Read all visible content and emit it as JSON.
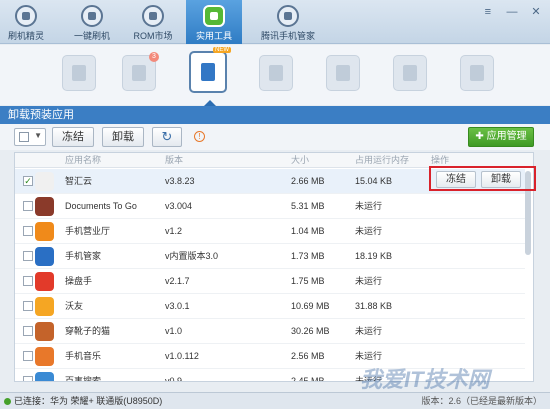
{
  "nav": {
    "items": [
      {
        "label": "刷机精灵",
        "icon": "logo-icon"
      },
      {
        "label": "一键刷机",
        "icon": "flash-icon"
      },
      {
        "label": "ROM市场",
        "icon": "rom-market-icon"
      },
      {
        "label": "实用工具",
        "icon": "tools-icon",
        "active": true
      },
      {
        "label": "腾讯手机管家",
        "icon": "shield-icon"
      }
    ],
    "window_buttons": [
      "≡",
      "—",
      "✕"
    ]
  },
  "tools": {
    "badge_count": "3",
    "new_tag": "NEW"
  },
  "section": {
    "title": "卸载预装应用"
  },
  "toolbar": {
    "freeze_label": "冻结",
    "uninstall_label": "卸载",
    "refresh_icon": "↻",
    "warn_icon": "!",
    "app_manage_label": "应用管理"
  },
  "table": {
    "columns": [
      "应用名称",
      "版本",
      "大小",
      "占用运行内存",
      "操作"
    ],
    "rows": [
      {
        "checked": true,
        "name": "智汇云",
        "version": "v3.8.23",
        "size": "2.66 MB",
        "memory": "15.04 KB",
        "color": "#f0f0f0"
      },
      {
        "checked": false,
        "name": "Documents To Go",
        "version": "v3.004",
        "size": "5.31 MB",
        "memory": "未运行",
        "color": "#8a3a2a"
      },
      {
        "checked": false,
        "name": "手机营业厅",
        "version": "v1.2",
        "size": "1.04 MB",
        "memory": "未运行",
        "color": "#f08a1a"
      },
      {
        "checked": false,
        "name": "手机管家",
        "version": "v内置版本3.0",
        "size": "1.73 MB",
        "memory": "18.19 KB",
        "color": "#2a6fc4"
      },
      {
        "checked": false,
        "name": "操盘手",
        "version": "v2.1.7",
        "size": "1.75 MB",
        "memory": "未运行",
        "color": "#e23a2a"
      },
      {
        "checked": false,
        "name": "沃友",
        "version": "v3.0.1",
        "size": "10.69 MB",
        "memory": "31.88 KB",
        "color": "#f5a623"
      },
      {
        "checked": false,
        "name": "穿靴子的猫",
        "version": "v1.0",
        "size": "30.26 MB",
        "memory": "未运行",
        "color": "#c4632a"
      },
      {
        "checked": false,
        "name": "手机音乐",
        "version": "v1.0.112",
        "size": "2.56 MB",
        "memory": "未运行",
        "color": "#e8782a"
      },
      {
        "checked": false,
        "name": "百事搜索",
        "version": "v0.9",
        "size": "2.45 MB",
        "memory": "未运行",
        "color": "#3a8ad4"
      }
    ],
    "action_freeze": "冻结",
    "action_uninstall": "卸载"
  },
  "status": {
    "connection": "已连接：华为 荣耀+ 联通版(U8950D)",
    "version": "版本：2.6（已经是最新版本）"
  },
  "watermark": "我爱IT技术网"
}
